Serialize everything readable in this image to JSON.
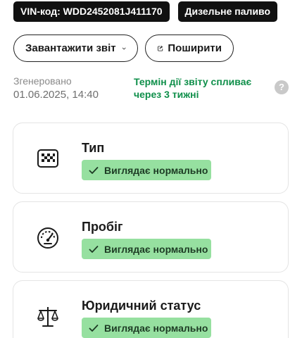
{
  "chips": {
    "vin": "VIN-код: WDD2452081J411170",
    "fuel": "Дизельне паливо"
  },
  "actions": {
    "download_label": "Завантажити звіт",
    "share_label": "Поширити"
  },
  "meta": {
    "generated_label": "Згенеровано",
    "generated_date": "01.06.2025, 14:40",
    "expiry": "Термін дії звіту спливає через 3 тижні",
    "help": "?"
  },
  "checks": [
    {
      "title": "Тип",
      "status": "Виглядає нормально",
      "icon": "taxi-icon"
    },
    {
      "title": "Пробіг",
      "status": "Виглядає нормально",
      "icon": "speedometer-icon"
    },
    {
      "title": "Юридичний статус",
      "status": "Виглядає нормально",
      "icon": "scales-icon"
    }
  ],
  "colors": {
    "accent_green": "#0f8f4a",
    "badge_bg": "#96e0a0",
    "chip_bg": "#111111"
  }
}
